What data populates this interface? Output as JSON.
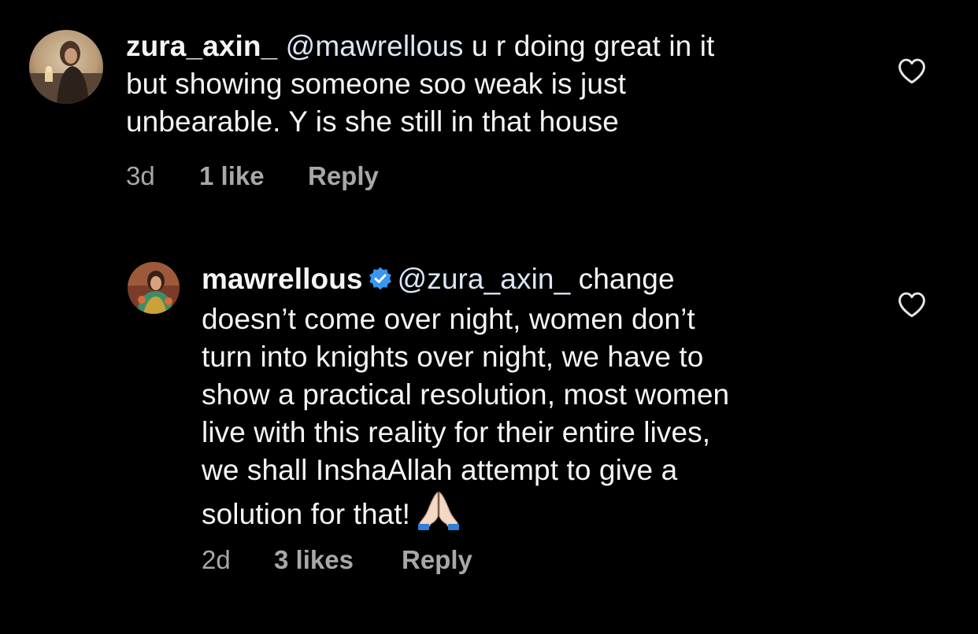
{
  "comments": [
    {
      "username": "zura_axin_",
      "mention": "@mawrellous",
      "line1_rest": " u r doing great in it",
      "line2": "but showing someone soo weak is just",
      "line3": "unbearable. Y is she still in that house",
      "time": "3d",
      "likes": "1 like",
      "reply": "Reply"
    },
    {
      "username": "mawrellous",
      "verified": true,
      "mention": "@zura_axin_",
      "line1_rest": " change",
      "line2": "doesn’t come over night, women don’t",
      "line3": "turn into knights over night, we have to",
      "line4": "show a practical resolution, most women",
      "line5": "live with this reality for their entire lives,",
      "line6": "we shall InshaAllah attempt to give a",
      "line7": "solution for that!",
      "emoji": "folded-hands",
      "time": "2d",
      "likes": "3 likes",
      "reply": "Reply"
    }
  ],
  "colors": {
    "background": "#000000",
    "text": "#f5f5f5",
    "secondary": "#a8a8a8",
    "verified": "#3897f0"
  }
}
